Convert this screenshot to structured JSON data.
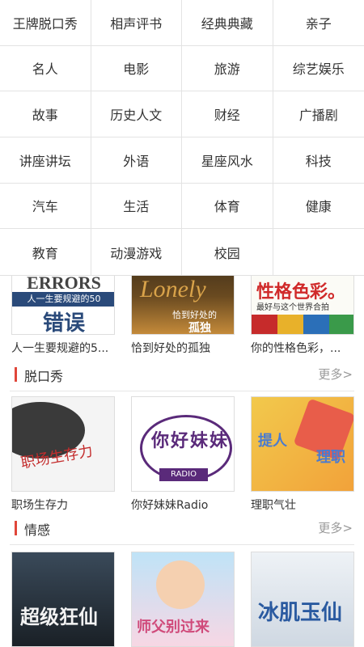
{
  "categories": [
    "王牌脱口秀",
    "相声评书",
    "经典典藏",
    "亲子",
    "名人",
    "电影",
    "旅游",
    "综艺娱乐",
    "故事",
    "历史人文",
    "财经",
    "广播剧",
    "讲座讲坛",
    "外语",
    "星座风水",
    "科技",
    "汽车",
    "生活",
    "体育",
    "健康",
    "教育",
    "动漫游戏",
    "校园",
    ""
  ],
  "top_row": [
    {
      "title": "人一生要规避的5...",
      "art": "ERRORS 人一生要规避的50 错误"
    },
    {
      "title": "恰到好处的孤独",
      "art": "Lonely 恰到好处的孤独"
    },
    {
      "title": "你的性格色彩，...",
      "art": "性格色彩 最好与这个世界合拍"
    }
  ],
  "sections": [
    {
      "title": "脱口秀",
      "more": "更多>",
      "items": [
        {
          "title": "职场生存力",
          "art": "职场生存力"
        },
        {
          "title": "你好妹妹Radio",
          "art": "你好妹妹 RADIO"
        },
        {
          "title": "理职气壮",
          "art": "理职气壮"
        }
      ]
    },
    {
      "title": "情感",
      "more": "更多>",
      "items": [
        {
          "title": "",
          "art": "超级狂仙"
        },
        {
          "title": "",
          "art": "师父别过来"
        },
        {
          "title": "",
          "art": "冰肌玉仙"
        }
      ]
    }
  ],
  "colors": {
    "accent": "#e0463a"
  }
}
